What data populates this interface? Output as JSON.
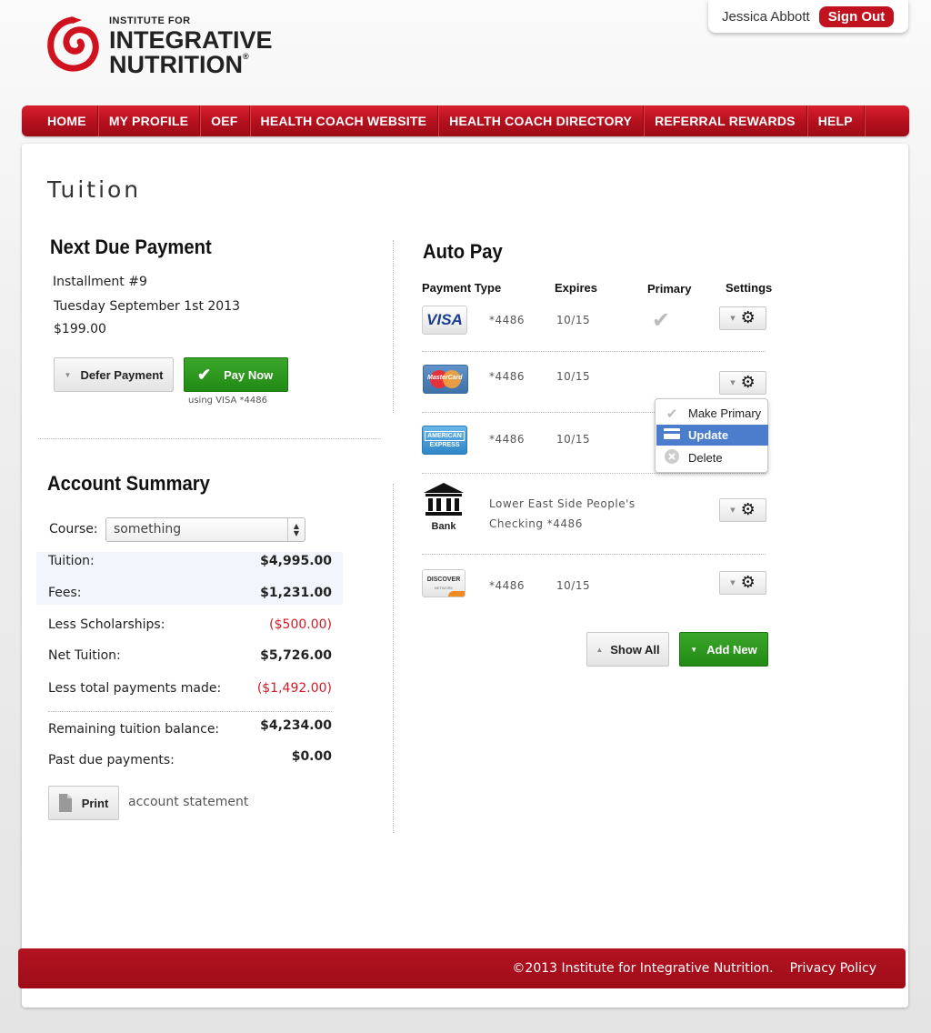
{
  "header": {
    "logo_line1": "INSTITUTE FOR",
    "logo_line2": "INTEGRATIVE",
    "logo_line3": "NUTRITION",
    "logo_mark": "®",
    "user_name": "Jessica Abbott",
    "sign_out": "Sign Out"
  },
  "nav": [
    "HOME",
    "MY PROFILE",
    "OEF",
    "HEALTH COACH WEBSITE",
    "HEALTH COACH DIRECTORY",
    "REFERRAL REWARDS",
    "HELP"
  ],
  "page_title": "Tuition",
  "next_due": {
    "heading": "Next Due Payment",
    "installment": "Installment #9",
    "date": "Tuesday September 1st  2013",
    "amount": "$199.00",
    "defer_label": "Defer Payment",
    "pay_label": "Pay Now",
    "using": "using VISA *4486"
  },
  "account_summary": {
    "heading": "Account Summary",
    "course_label": "Course:",
    "course_value": "something",
    "rows": [
      {
        "label": "Tuition:",
        "value": "$4,995.00"
      },
      {
        "label": "Fees:",
        "value": "$1,231.00"
      },
      {
        "label": "Less Scholarships:",
        "value": "($500.00)"
      },
      {
        "label": "Net Tuition:",
        "value": "$5,726.00"
      },
      {
        "label": "Less total payments made:",
        "value": "($1,492.00)"
      },
      {
        "label": "Remaining tuition balance:",
        "value": "$4,234.00"
      },
      {
        "label": "Past due payments:",
        "value": "$0.00"
      }
    ],
    "print_label": "Print",
    "statement_label": "account statement"
  },
  "auto_pay": {
    "heading": "Auto Pay",
    "columns": [
      "Payment Type",
      "Expires",
      "Primary",
      "Settings"
    ],
    "methods": [
      {
        "brand": "VISA",
        "number": "*4486",
        "expires": "10/15"
      },
      {
        "brand": "MasterCard",
        "number": "*4486",
        "expires": "10/15"
      },
      {
        "brand_line1": "AMERICAN",
        "brand_line2": "EXPRESS",
        "number": "*4486",
        "expires": "10/15"
      },
      {
        "brand": "Bank",
        "line1": "Lower East Side People's",
        "line2": "Checking *4486"
      },
      {
        "brand": "DISCOVER",
        "sub": "NETWORK",
        "number": "*4486",
        "expires": "10/15"
      }
    ],
    "menu": [
      "Make Primary",
      "Update",
      "Delete"
    ],
    "show_all": "Show All",
    "add_new": "Add New"
  },
  "footer": {
    "copyright": "©2013 Institute for Integrative Nutrition.",
    "privacy": "Privacy Policy"
  },
  "colors": {
    "brand_red": "#b3101d",
    "green": "#2a961c",
    "negative": "#d01b28",
    "menu_active": "#4b7dcc"
  }
}
